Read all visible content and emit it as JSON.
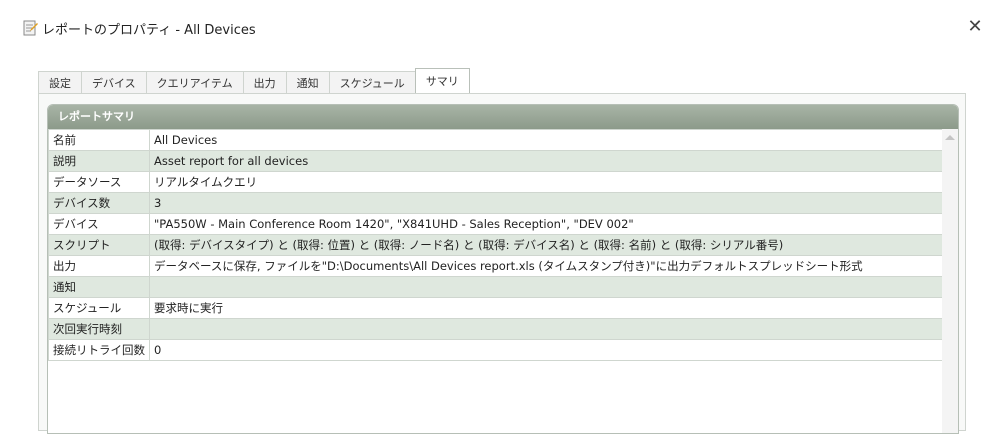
{
  "window": {
    "title": "レポートのプロパティ - All Devices",
    "close_glyph": "✕"
  },
  "tabs": [
    {
      "label": "設定",
      "active": false
    },
    {
      "label": "デバイス",
      "active": false
    },
    {
      "label": "クエリアイテム",
      "active": false
    },
    {
      "label": "出力",
      "active": false
    },
    {
      "label": "通知",
      "active": false
    },
    {
      "label": "スケジュール",
      "active": false
    },
    {
      "label": "サマリ",
      "active": true
    }
  ],
  "summary": {
    "header": "レポートサマリ",
    "rows": [
      {
        "label": "名前",
        "value": "All Devices"
      },
      {
        "label": "説明",
        "value": "Asset report for all devices"
      },
      {
        "label": "データソース",
        "value": "リアルタイムクエリ"
      },
      {
        "label": "デバイス数",
        "value": "3"
      },
      {
        "label": "デバイス",
        "value": "\"PA550W - Main Conference Room 1420\", \"X841UHD - Sales Reception\", \"DEV 002\""
      },
      {
        "label": "スクリプト",
        "value": "(取得: デバイスタイプ) と (取得: 位置) と (取得: ノード名) と (取得: デバイス名) と (取得: 名前) と (取得: シリアル番号)"
      },
      {
        "label": "出力",
        "value": "データベースに保存, ファイルを\"D:\\Documents\\All Devices report.xls (タイムスタンプ付き)\"に出力デフォルトスプレッドシート形式"
      },
      {
        "label": "通知",
        "value": ""
      },
      {
        "label": "スケジュール",
        "value": "要求時に実行"
      },
      {
        "label": "次回実行時刻",
        "value": ""
      },
      {
        "label": "接続リトライ回数",
        "value": "0"
      }
    ]
  },
  "colors": {
    "header_bg": "#98a596",
    "row_alt": "#dfe8df",
    "border": "#cfd6cf"
  }
}
